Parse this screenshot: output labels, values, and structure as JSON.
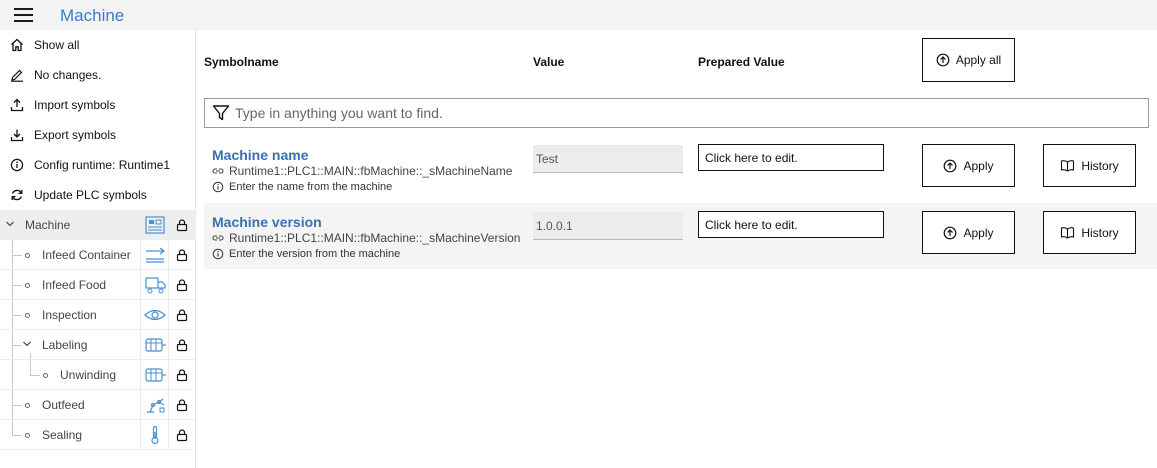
{
  "app": {
    "title": "Machine"
  },
  "sidebar": {
    "menu": [
      {
        "icon": "home-icon",
        "label": "Show all"
      },
      {
        "icon": "pencil-icon",
        "label": "No changes."
      },
      {
        "icon": "upload-icon",
        "label": "Import symbols"
      },
      {
        "icon": "download-icon",
        "label": "Export symbols"
      },
      {
        "icon": "info-icon",
        "label": "Config runtime: Runtime1"
      },
      {
        "icon": "refresh-icon",
        "label": "Update PLC symbols"
      }
    ],
    "tree": [
      {
        "label": "Machine",
        "level": 0,
        "expanded": true,
        "selected": true,
        "icon": "machine-icon",
        "locked": true
      },
      {
        "label": "Infeed Container",
        "level": 1,
        "icon": "conveyor-arrow-icon",
        "locked": true
      },
      {
        "label": "Infeed Food",
        "level": 1,
        "icon": "truck-icon",
        "locked": true
      },
      {
        "label": "Inspection",
        "level": 1,
        "icon": "eye-icon",
        "locked": true
      },
      {
        "label": "Labeling",
        "level": 1,
        "expanded": true,
        "icon": "label-machine-icon",
        "locked": true
      },
      {
        "label": "Unwinding",
        "level": 2,
        "icon": "label-machine-icon",
        "locked": true
      },
      {
        "label": "Outfeed",
        "level": 1,
        "icon": "robot-icon",
        "locked": true
      },
      {
        "label": "Sealing",
        "level": 1,
        "icon": "thermometer-icon",
        "locked": true
      }
    ]
  },
  "table": {
    "headers": {
      "symbolname": "Symbolname",
      "value": "Value",
      "prepared": "Prepared Value"
    },
    "apply_all_label": "Apply all",
    "filter_placeholder": "Type in anything you want to find.",
    "rows": [
      {
        "name": "Machine name",
        "path": "Runtime1::PLC1::MAIN::fbMachine::_sMachineName",
        "description": "Enter the name from the machine",
        "value": "Test",
        "prepared_placeholder": "Click here to edit.",
        "apply_label": "Apply",
        "history_label": "History"
      },
      {
        "name": "Machine version",
        "path": "Runtime1::PLC1::MAIN::fbMachine::_sMachineVersion",
        "description": "Enter the version from the machine",
        "value": "1.0.0.1",
        "prepared_placeholder": "Click here to edit.",
        "apply_label": "Apply",
        "history_label": "History"
      }
    ]
  },
  "colors": {
    "accent": "#3a7cc7",
    "link": "#3a6fb5",
    "icon": "#4a8fd0"
  }
}
